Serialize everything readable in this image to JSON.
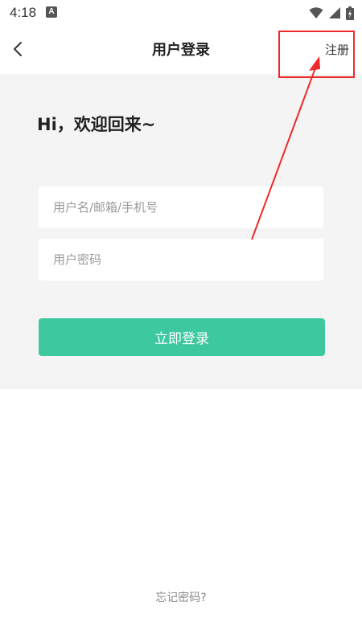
{
  "status_bar": {
    "time": "4:18",
    "notification_icon": "a-icon",
    "icons": [
      "wifi-icon",
      "signal-icon",
      "battery-icon"
    ]
  },
  "header": {
    "back_icon": "chevron-left-icon",
    "title": "用户登录",
    "register_label": "注册"
  },
  "main": {
    "greeting": "Hi，欢迎回来~",
    "username_placeholder": "用户名/邮箱/手机号",
    "password_placeholder": "用户密码",
    "username_value": "",
    "password_value": "",
    "login_label": "立即登录",
    "forgot_label": "忘记密码?"
  },
  "colors": {
    "accent": "#3dc8a0",
    "panel_background": "#f4f4f4",
    "annotation": "#ee2a2a"
  }
}
